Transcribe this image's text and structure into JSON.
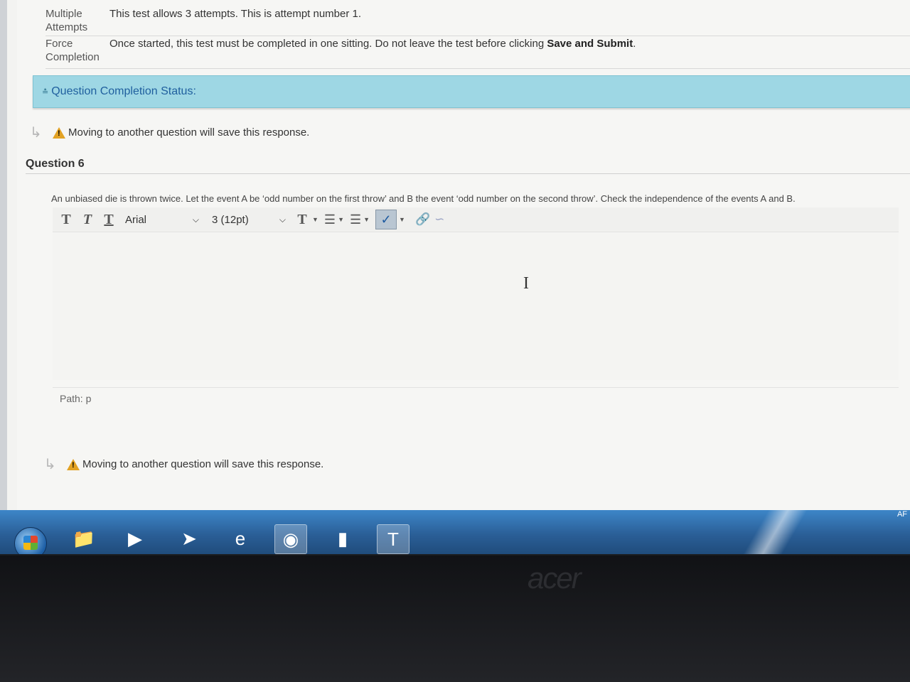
{
  "test_info": {
    "multiple_attempts": {
      "label": "Multiple Attempts",
      "text": "This test allows 3 attempts. This is attempt number 1."
    },
    "force_completion": {
      "label": "Force Completion",
      "text_before": "Once started, this test must be completed in one sitting. Do not leave the test before clicking",
      "text_bold": "Save and Submit",
      "text_after": "."
    }
  },
  "status_bar": {
    "label": "Question Completion Status:"
  },
  "notice": {
    "text": "Moving to another question will save this response."
  },
  "question": {
    "title": "Question 6",
    "text": "An unbiased die is thrown twice. Let the event A be ‘odd number on the first throw’ and B the event ‘odd number on the second throw’. Check the independence of the events A and B."
  },
  "toolbar": {
    "font_family": "Arial",
    "font_size": "3 (12pt)"
  },
  "editor": {
    "path_label": "Path: p"
  },
  "taskbar": {
    "tray_text": "AF"
  },
  "brand": "acer",
  "icons": {
    "warning": "warning-icon",
    "start": "windows-start-icon"
  }
}
